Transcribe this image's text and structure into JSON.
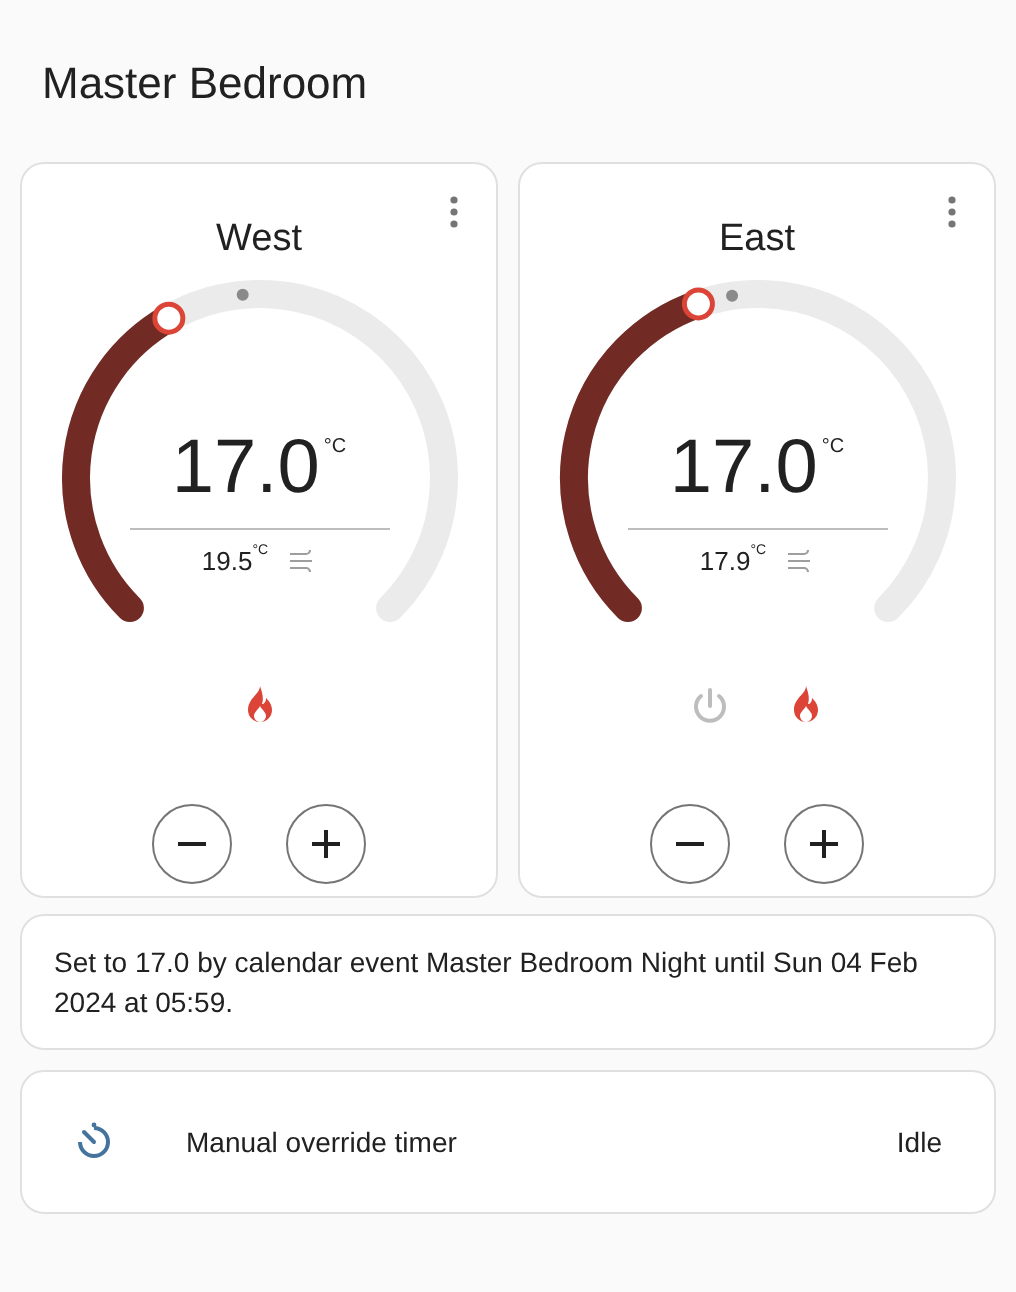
{
  "title": "Master Bedroom",
  "thermostats": [
    {
      "name": "West",
      "target_value": "17.0",
      "target_unit": "°C",
      "current_value": "19.5",
      "current_unit": "°C",
      "modes": [
        {
          "kind": "heat",
          "active": true
        }
      ]
    },
    {
      "name": "East",
      "target_value": "17.0",
      "target_unit": "°C",
      "current_value": "17.9",
      "current_unit": "°C",
      "modes": [
        {
          "kind": "off",
          "active": false
        },
        {
          "kind": "heat",
          "active": true
        }
      ]
    }
  ],
  "info": "Set to 17.0 by calendar event Master Bedroom Night until Sun 04 Feb 2024 at 05:59.",
  "timer": {
    "label": "Manual override timer",
    "state": "Idle"
  }
}
